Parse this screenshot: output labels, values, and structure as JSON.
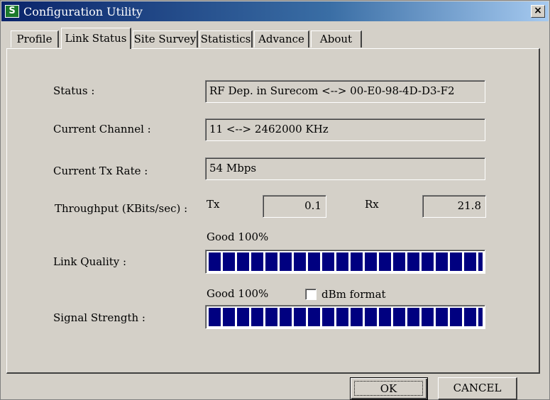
{
  "window": {
    "title": "Configuration Utility",
    "close_glyph": "×",
    "app_icon_glyph": "S"
  },
  "tabs": [
    {
      "label": "Profile"
    },
    {
      "label": "Link Status"
    },
    {
      "label": "Site Survey"
    },
    {
      "label": "Statistics"
    },
    {
      "label": "Advance"
    },
    {
      "label": "About"
    }
  ],
  "active_tab": "Link Status",
  "link_status": {
    "status_label": "Status :",
    "status_value": "RF Dep. in Surecom <--> 00-E0-98-4D-D3-F2",
    "channel_label": "Current Channel :",
    "channel_value": "11 <--> 2462000 KHz",
    "txrate_label": "Current Tx Rate :",
    "txrate_value": "54 Mbps",
    "throughput_label": "Throughput (KBits/sec) :",
    "tx_label": "Tx",
    "tx_value": "0.1",
    "rx_label": "Rx",
    "rx_value": "21.8",
    "link_quality_text": "Good 100%",
    "link_quality_label": "Link Quality :",
    "link_quality_percent": 100,
    "signal_text": "Good 100%",
    "dbm_label": "dBm format",
    "dbm_checked": false,
    "signal_label": "Signal Strength :",
    "signal_percent": 100
  },
  "buttons": {
    "ok": "OK",
    "cancel": "CANCEL"
  },
  "colors": {
    "titlebar": "#0a246a",
    "bar_fill": "#000080",
    "face": "#d4d0c8"
  }
}
